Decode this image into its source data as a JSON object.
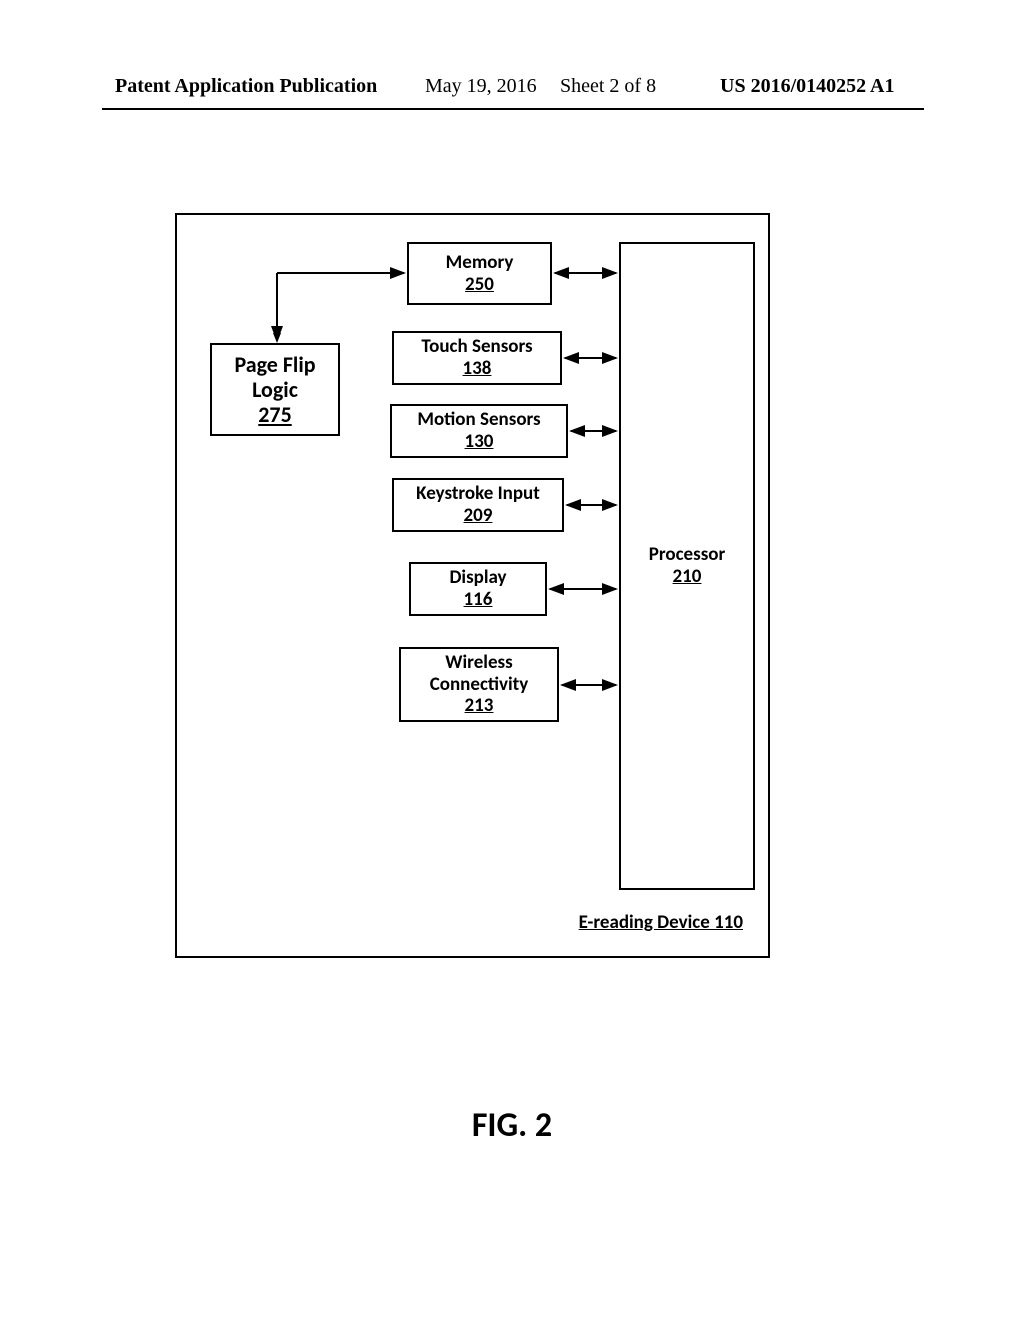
{
  "header": {
    "pub_label": "Patent Application Publication",
    "date": "May 19, 2016",
    "sheet": "Sheet 2 of 8",
    "pubnum": "US 2016/0140252 A1"
  },
  "boxes": {
    "pageflip": {
      "title": "Page Flip Logic",
      "num": "275"
    },
    "memory": {
      "title": "Memory",
      "num": "250"
    },
    "touch": {
      "title": "Touch Sensors",
      "num": "138"
    },
    "motion": {
      "title": "Motion Sensors",
      "num": "130"
    },
    "keystroke": {
      "title": "Keystroke Input",
      "num": "209"
    },
    "display": {
      "title": "Display",
      "num": "116"
    },
    "wireless": {
      "title": "Wireless Connectivity",
      "num": "213"
    },
    "processor": {
      "title": "Processor",
      "num": "210"
    }
  },
  "device_label": "E-reading Device 110",
  "figure_caption": "FIG. 2"
}
